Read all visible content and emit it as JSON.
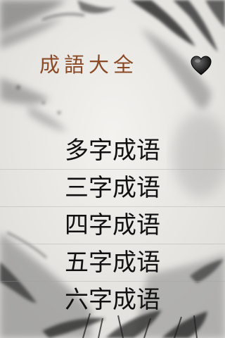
{
  "header": {
    "title": "成語大全",
    "favorite_icon": "heart-icon"
  },
  "menu": {
    "items": [
      {
        "label": "多字成语"
      },
      {
        "label": "三字成语"
      },
      {
        "label": "四字成语"
      },
      {
        "label": "五字成语"
      },
      {
        "label": "六字成语"
      }
    ]
  },
  "colors": {
    "title": "#8a4a26",
    "menu_text": "#111111",
    "background": "#ecebe8",
    "ink": "#2a2a2a"
  }
}
